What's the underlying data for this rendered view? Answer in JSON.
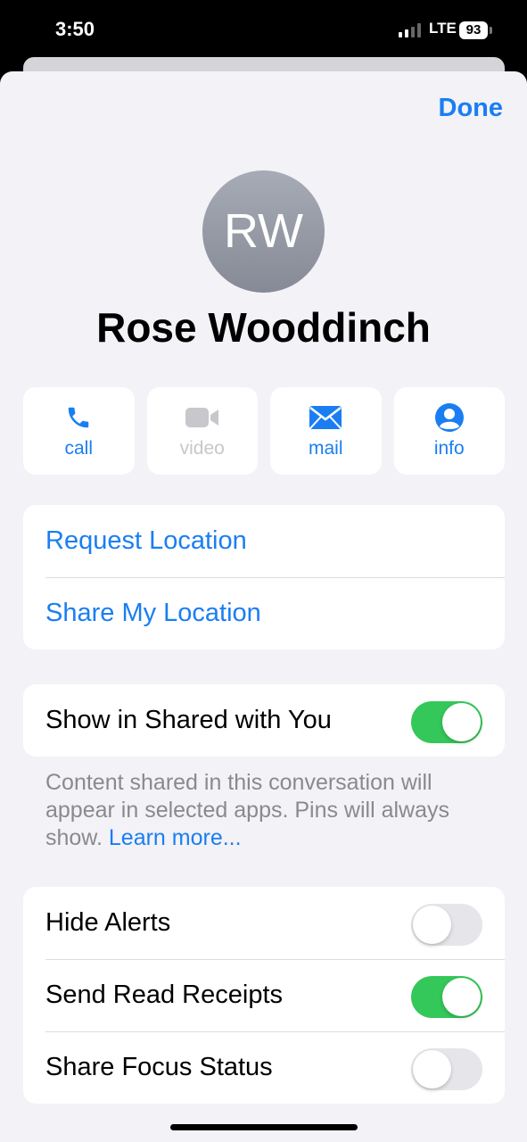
{
  "status_bar": {
    "time": "3:50",
    "network": "LTE",
    "battery": "93"
  },
  "header": {
    "done_label": "Done"
  },
  "contact": {
    "initials": "RW",
    "name": "Rose Wooddinch"
  },
  "actions": [
    {
      "label": "call",
      "icon": "phone-icon",
      "enabled": true
    },
    {
      "label": "video",
      "icon": "video-camera-icon",
      "enabled": false
    },
    {
      "label": "mail",
      "icon": "envelope-icon",
      "enabled": true
    },
    {
      "label": "info",
      "icon": "person-circle-icon",
      "enabled": true
    }
  ],
  "location": {
    "request": "Request Location",
    "share": "Share My Location"
  },
  "shared_with_you": {
    "label": "Show in Shared with You",
    "on": true,
    "footnote": "Content shared in this conversation will appear in selected apps. Pins will always show.",
    "learn_more": "Learn more..."
  },
  "settings": [
    {
      "label": "Hide Alerts",
      "on": false
    },
    {
      "label": "Send Read Receipts",
      "on": true
    },
    {
      "label": "Share Focus Status",
      "on": false
    }
  ],
  "colors": {
    "accent": "#1a7ef2",
    "toggle_on": "#34c759",
    "background": "#f2f2f7"
  }
}
